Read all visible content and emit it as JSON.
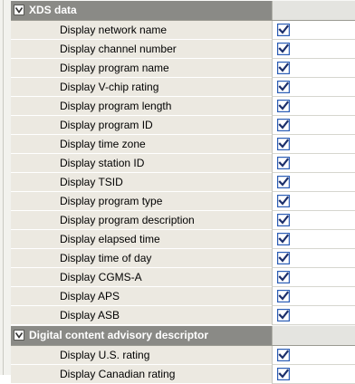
{
  "colors": {
    "section_header": "#8a8a86",
    "row_background": "#ece9e1",
    "check_accent": "#2b5db5"
  },
  "sections": [
    {
      "title": "XDS data",
      "expanded": true,
      "items": [
        {
          "label": "Display network name",
          "checked": true
        },
        {
          "label": "Display channel number",
          "checked": true
        },
        {
          "label": "Display program name",
          "checked": true
        },
        {
          "label": "Display V-chip rating",
          "checked": true
        },
        {
          "label": "Display program length",
          "checked": true
        },
        {
          "label": "Display program ID",
          "checked": true
        },
        {
          "label": "Display time zone",
          "checked": true
        },
        {
          "label": "Display station ID",
          "checked": true
        },
        {
          "label": "Display TSID",
          "checked": true
        },
        {
          "label": "Display program type",
          "checked": true
        },
        {
          "label": "Display program description",
          "checked": true
        },
        {
          "label": "Display elapsed time",
          "checked": true
        },
        {
          "label": "Display time of day",
          "checked": true
        },
        {
          "label": "Display CGMS-A",
          "checked": true
        },
        {
          "label": "Display APS",
          "checked": true
        },
        {
          "label": "Display ASB",
          "checked": true
        }
      ]
    },
    {
      "title": "Digital content advisory descriptor",
      "expanded": true,
      "items": [
        {
          "label": "Display U.S. rating",
          "checked": true
        },
        {
          "label": "Display Canadian rating",
          "checked": true
        }
      ]
    }
  ]
}
